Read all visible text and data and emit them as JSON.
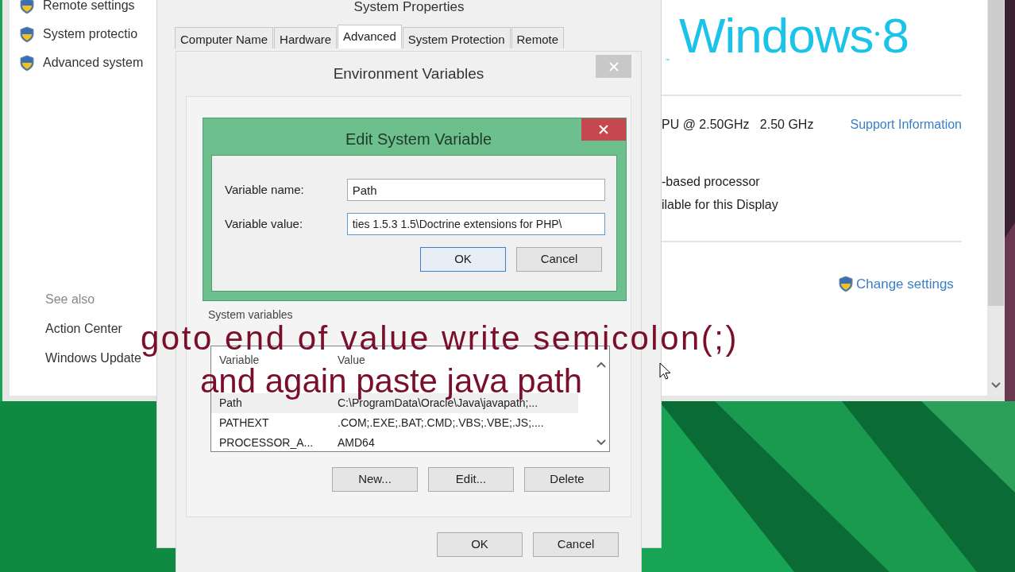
{
  "control_panel": {
    "tasks": [
      {
        "label": "Remote settings"
      },
      {
        "label": "System protectio"
      },
      {
        "label": "Advanced system"
      }
    ],
    "see_also": {
      "heading": "See also",
      "links": [
        "Action Center",
        "Windows Update"
      ]
    },
    "logo": {
      "name": "Windows",
      "version": "8",
      "mark": "™"
    },
    "processor": "PU @ 2.50GHz   2.50 GHz",
    "support_link": "Support Information",
    "system_type": "-based processor",
    "pen_touch": "ilable for this Display",
    "change_settings": "Change settings"
  },
  "system_properties": {
    "title": "System Properties",
    "tabs": [
      {
        "label": "Computer Name",
        "selected": false
      },
      {
        "label": "Hardware",
        "selected": false
      },
      {
        "label": "Advanced",
        "selected": true
      },
      {
        "label": "System Protection",
        "selected": false
      },
      {
        "label": "Remote",
        "selected": false
      }
    ]
  },
  "environment_variables": {
    "title": "Environment Variables",
    "system_variables": {
      "label": "System variables",
      "columns": [
        "Variable",
        "Value"
      ],
      "rows": [
        {
          "variable": "",
          "value": "",
          "selected": false
        },
        {
          "variable": "Path",
          "value": "C:\\ProgramData\\Oracle\\Java\\javapath;...",
          "selected": true
        },
        {
          "variable": "PATHEXT",
          "value": ".COM;.EXE;.BAT;.CMD;.VBS;.VBE;.JS;....",
          "selected": false
        },
        {
          "variable": "PROCESSOR_A...",
          "value": "AMD64",
          "selected": false
        }
      ]
    },
    "list_buttons": [
      "New...",
      "Edit...",
      "Delete"
    ],
    "dialog_buttons": [
      "OK",
      "Cancel"
    ]
  },
  "edit_dialog": {
    "title": "Edit System Variable",
    "fields": [
      {
        "label": "Variable name:",
        "value": "Path",
        "focused": false
      },
      {
        "label": "Variable value:",
        "value": "ties 1.5.3 1.5\\Doctrine extensions for PHP\\",
        "focused": true
      }
    ],
    "buttons": [
      {
        "label": "OK",
        "default": true
      },
      {
        "label": "Cancel",
        "default": false
      }
    ]
  },
  "caption": {
    "lines": [
      "goto end of value write semicolon(;)",
      "and again paste java path"
    ]
  }
}
